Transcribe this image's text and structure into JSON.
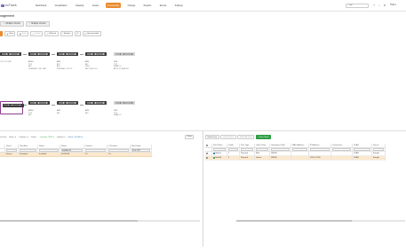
{
  "logo": {
    "text": "ecTrack"
  },
  "nav": {
    "items": [
      {
        "label": "Dashboard",
        "active": false
      },
      {
        "label": "Visualization",
        "active": false
      },
      {
        "label": "Capacity",
        "active": false
      },
      {
        "label": "Assets",
        "active": false
      },
      {
        "label": "Connectivity",
        "active": true
      },
      {
        "label": "Change",
        "active": false
      },
      {
        "label": "Reports",
        "active": false
      },
      {
        "label": "Events",
        "active": false
      },
      {
        "label": "Settings",
        "active": false
      }
    ],
    "search_value": "sign",
    "user": "TMA"
  },
  "page": {
    "subtitle": "nagement"
  },
  "tabs": [
    {
      "label": "Multiple Circuits"
    },
    {
      "label": "Multiple Circuits"
    }
  ],
  "toolbar": {
    "buttons": [
      {
        "label": "View",
        "dim": false
      },
      {
        "label": "Save",
        "dim": true
      },
      {
        "label": "Delete",
        "dim": true
      },
      {
        "label": "Refresh",
        "dim": false
      },
      {
        "label": "Actions",
        "dim": false
      },
      {
        "label": "Unassociated",
        "dim": false
      }
    ]
  },
  "devices_row1": [
    {
      "line1": "",
      "line2": "",
      "line3": "",
      "line4": "I T.C.5 T.2 | 8.8",
      "light": false
    },
    {
      "line1": "AW9H",
      "line2": "T.2.2",
      "line3": "60C",
      "line4": "CONCE A C / 14 / 1.6B",
      "light": false
    },
    {
      "line1": "AW3",
      "line2": "64C",
      "line3": "A C.I",
      "line4": "PCFF A.E.C / 4 / 2.0",
      "light": false
    },
    {
      "line1": "AW4",
      "line2": "60C",
      "line3": "D-4-4",
      "line4": "DE.C 1 A.C.I.C.I",
      "light": false
    },
    {
      "line1": "3/9N",
      "line2": "T.2.2",
      "line3": "SLAN C.C",
      "line4": "ATC 4.2 / 20.FE 2.8",
      "light": true
    }
  ],
  "devices_row2": [
    {
      "line1": "",
      "line2": "",
      "line3": "",
      "line4": "",
      "light": false
    },
    {
      "line1": "AW9H",
      "line2": "T.2.2",
      "line3": "60C",
      "line4": "",
      "light": false
    },
    {
      "line1": "AW3",
      "line2": "64C",
      "line3": "",
      "line4": "",
      "light": false
    },
    {
      "line1": "AW4",
      "line2": "60C",
      "line3": "",
      "line4": "",
      "light": false
    },
    {
      "line1": "3/9N",
      "line2": "T.2.2",
      "line3": "SLAN C.C",
      "line4": "",
      "light": true
    }
  ],
  "left_panel": {
    "filters": [
      {
        "label": "ul Ports",
        "class": ""
      },
      {
        "label": "Rows: ▾",
        "class": ""
      },
      {
        "label": "Columns: ▾",
        "class": ""
      },
      {
        "label": "Filters:",
        "class": ""
      },
      {
        "label": "Location: 3781 ▾",
        "class": "green"
      },
      {
        "label": "Cabinet: ▾",
        "class": ""
      },
      {
        "label": "Name: ScX000 ▾",
        "class": "blue"
      }
    ],
    "clear_label": "Clear",
    "columns": [
      "",
      "Client",
      "Port Area",
      "Name",
      "Name",
      "Cabinet",
      "U Position",
      "Slot Under"
    ],
    "filter_values": [
      "",
      "",
      "",
      "",
      "VadNet M",
      "",
      "",
      "XVn OPT"
    ],
    "row": [
      "",
      "Storno",
      "Standard",
      "Installed",
      "4L6/0018",
      "10",
      "13",
      ""
    ]
  },
  "right_panel": {
    "buttons": [
      {
        "label": "Node Ports",
        "dim": false,
        "green": false
      },
      {
        "label": "Create Ports",
        "dim": true,
        "green": false
      },
      {
        "label": "Show All Ports",
        "dim": true,
        "green": false
      },
      {
        "label": "+ New Node",
        "dim": false,
        "green": true
      }
    ],
    "columns": [
      "",
      "Port Name",
      "Cable",
      "Port Type",
      "Label Color",
      "Grouping Profile",
      "MAC Address",
      "IP Address",
      "Connection",
      "VLAN",
      "Securi"
    ],
    "rows": [
      {
        "cells": [
          "",
          "Nw01s",
          "1",
          "Physical",
          "Blue",
          "PR930",
          "",
          "",
          "",
          "VLAN",
          "Everyb"
        ],
        "dot": "#2b6cb0",
        "alt": false
      },
      {
        "cells": [
          "",
          "Nw02b",
          "2",
          "Physical",
          "Green",
          "PR930",
          "",
          "192.0.2.200",
          "",
          "VLAN",
          "Everyb"
        ],
        "dot": "#2f9e44",
        "alt": true
      }
    ]
  }
}
